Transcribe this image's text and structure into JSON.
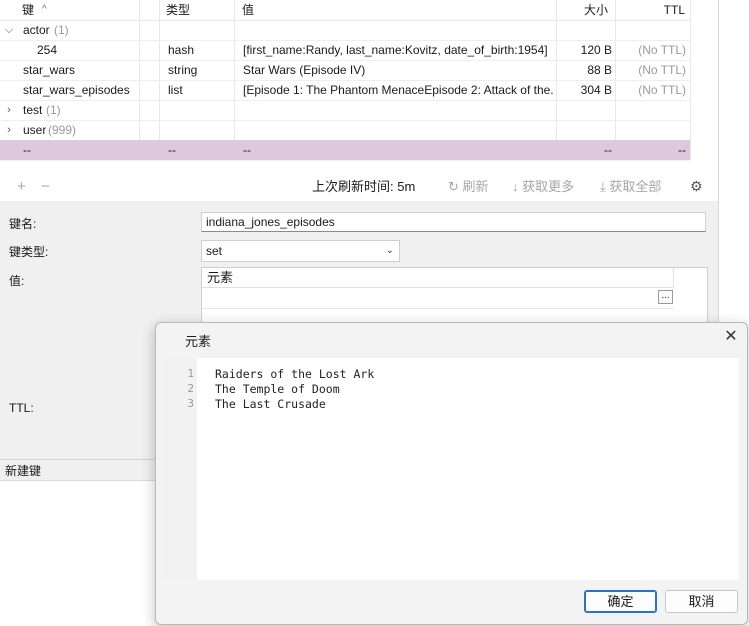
{
  "table": {
    "headers": {
      "key": "键",
      "sort_indicator": "^",
      "type": "类型",
      "value": "值",
      "size": "大小",
      "ttl": "TTL"
    },
    "rows": [
      {
        "key": "actor",
        "count": "(1)",
        "toggle": "v",
        "type": "",
        "value": "",
        "size": "",
        "ttl": ""
      },
      {
        "key": "254",
        "count": "",
        "toggle": "",
        "type": "hash",
        "value": "[first_name:Randy, last_name:Kovitz, date_of_birth:1954]",
        "size": "120 B",
        "ttl": "(No TTL)"
      },
      {
        "key": "star_wars",
        "count": "",
        "toggle": "",
        "type": "string",
        "value": "Star Wars (Episode IV)",
        "size": "88 B",
        "ttl": "(No TTL)"
      },
      {
        "key": "star_wars_episodes",
        "count": "",
        "toggle": "",
        "type": "list",
        "value": "[Episode 1: The Phantom MenaceEpisode 2: Attack of the...",
        "size": "304 B",
        "ttl": "(No TTL)"
      },
      {
        "key": "test",
        "count": "(1)",
        "toggle": ">",
        "type": "",
        "value": "",
        "size": "",
        "ttl": ""
      },
      {
        "key": "user",
        "count": "(999)",
        "toggle": ">",
        "type": "",
        "value": "",
        "size": "",
        "ttl": ""
      }
    ],
    "selected_row": {
      "key": "--",
      "type": "--",
      "value": "--",
      "size": "--",
      "ttl": "--"
    }
  },
  "toolbar": {
    "add": "+",
    "remove": "−",
    "last_refresh": "上次刷新时间: 5m",
    "refresh": "刷新",
    "fetch_more": "获取更多",
    "fetch_all": "获取全部",
    "icons": {
      "refresh": "refresh-icon",
      "fetch_more": "arrow-down-icon",
      "fetch_all": "download-icon",
      "settings": "gear-icon"
    }
  },
  "form": {
    "key_name_label": "键名:",
    "key_name_value": "indiana_jones_episodes",
    "key_type_label": "键类型:",
    "key_type_value": "set",
    "value_label": "值:",
    "value_column_header": "元素",
    "ttl_label": "TTL:"
  },
  "status_bar": {
    "text": "新建键"
  },
  "dialog": {
    "title": "元素",
    "close": "✕",
    "lines": [
      {
        "n": "1",
        "text": "Raiders of the Lost Ark"
      },
      {
        "n": "2",
        "text": "The Temple of Doom"
      },
      {
        "n": "3",
        "text": "The Last Crusade"
      }
    ],
    "ok": "确定",
    "cancel": "取消"
  },
  "colors": {
    "selected_row": "#ddc8dd",
    "primary_border": "#2a72c8",
    "muted_text": "#9a9a9a"
  }
}
